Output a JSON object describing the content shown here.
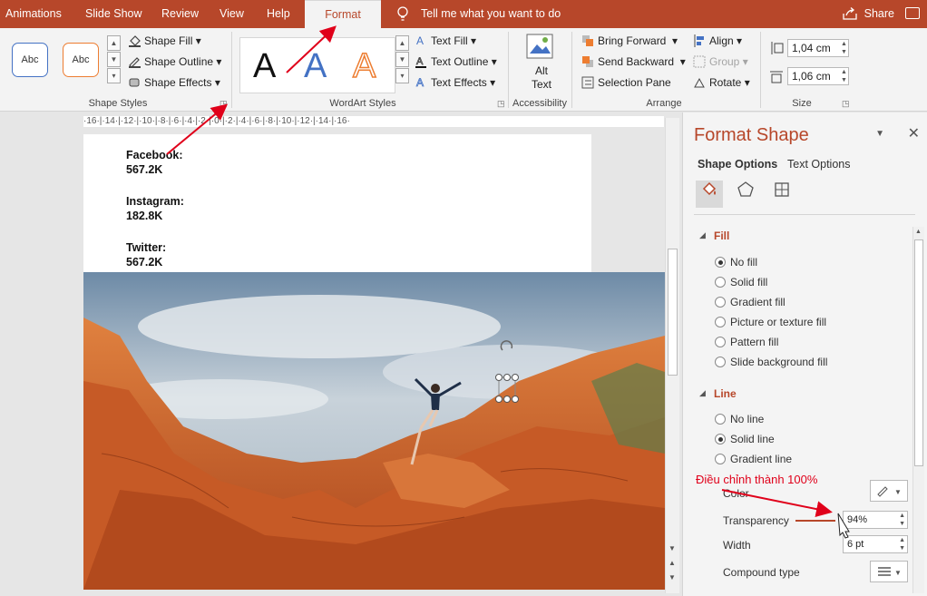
{
  "tabs": [
    {
      "label": "Animations",
      "active": false
    },
    {
      "label": "Slide Show",
      "active": false
    },
    {
      "label": "Review",
      "active": false
    },
    {
      "label": "View",
      "active": false
    },
    {
      "label": "Help",
      "active": false
    },
    {
      "label": "Format",
      "active": true
    }
  ],
  "tellme": "Tell me what you want to do",
  "share": "Share",
  "ribbon": {
    "shape_styles": {
      "style1": "Abc",
      "style2": "Abc",
      "fill": "Shape Fill",
      "outline": "Shape Outline",
      "effects": "Shape Effects",
      "label": "Shape Styles"
    },
    "wordart": {
      "sample": "A",
      "text_fill": "Text Fill",
      "text_outline": "Text Outline",
      "text_effects": "Text Effects",
      "label": "WordArt Styles"
    },
    "accessibility": {
      "alt_text_1": "Alt",
      "alt_text_2": "Text",
      "label": "Accessibility"
    },
    "arrange": {
      "bring_forward": "Bring Forward",
      "send_backward": "Send Backward",
      "selection_pane": "Selection Pane",
      "align": "Align",
      "group": "Group",
      "rotate": "Rotate",
      "label": "Arrange"
    },
    "size": {
      "height": "1,04 cm",
      "width": "1,06 cm",
      "label": "Size"
    }
  },
  "ruler_text": "·16·|·14·|·12·|·10·|·8·|·6·|·4·|·2·|·0·|·2·|·4·|·6·|·8·|·10·|·12·|·14·|·16·",
  "slide": {
    "items": [
      {
        "name": "Facebook:",
        "value": "567.2K"
      },
      {
        "name": "Instagram:",
        "value": "182.8K"
      },
      {
        "name": "Twitter:",
        "value": "567.2K"
      }
    ]
  },
  "pane": {
    "title": "Format Shape",
    "tab_shape": "Shape Options",
    "tab_text": "Text Options",
    "fill_header": "Fill",
    "fill_options": [
      {
        "label": "No fill",
        "checked": true
      },
      {
        "label": "Solid fill",
        "checked": false
      },
      {
        "label": "Gradient fill",
        "checked": false
      },
      {
        "label": "Picture or texture fill",
        "checked": false
      },
      {
        "label": "Pattern fill",
        "checked": false
      },
      {
        "label": "Slide background fill",
        "checked": false
      }
    ],
    "line_header": "Line",
    "line_options": [
      {
        "label": "No line",
        "checked": false
      },
      {
        "label": "Solid line",
        "checked": true
      },
      {
        "label": "Gradient line",
        "checked": false
      }
    ],
    "color_label": "Color",
    "transparency_label": "Transparency",
    "transparency_value": "94%",
    "width_label": "Width",
    "width_value": "6 pt",
    "compound_label": "Compound type"
  },
  "annotation": "Điều chỉnh thành 100%",
  "colors": {
    "accent": "#b7472a",
    "annotation": "#e0001a"
  }
}
